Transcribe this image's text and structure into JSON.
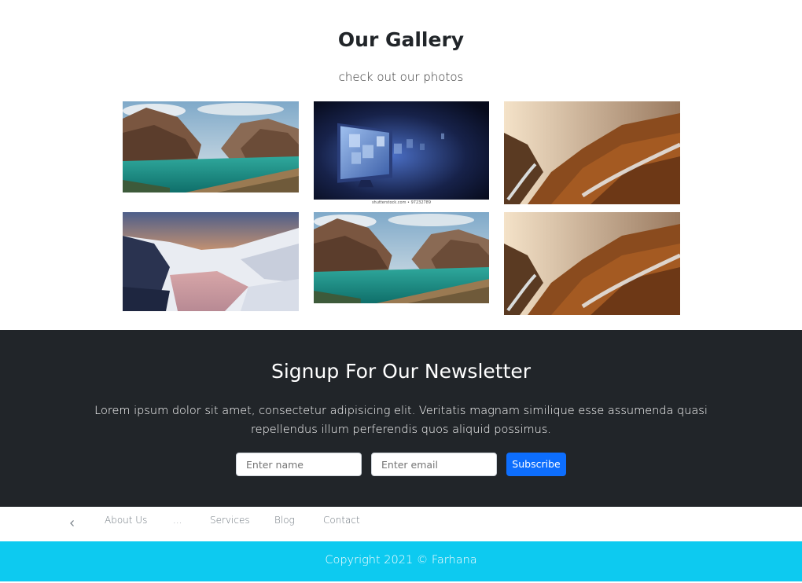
{
  "gallery": {
    "title": "Our Gallery",
    "subtitle": "check out our photos",
    "photos": [
      {
        "subject": "fjord-lake",
        "caption": ""
      },
      {
        "subject": "blue-monitor",
        "caption": "shutterstock.com • 97232789"
      },
      {
        "subject": "autumn-valley",
        "caption": ""
      },
      {
        "subject": "snow-lake-sunset",
        "caption": ""
      },
      {
        "subject": "fjord-lake",
        "caption": ""
      },
      {
        "subject": "autumn-valley",
        "caption": ""
      }
    ]
  },
  "newsletter": {
    "title": "Signup For Our Newsletter",
    "text": "Lorem ipsum dolor sit amet, consectetur adipisicing elit. Veritatis magnam similique esse assumenda quasi repellendus illum perferendis quos aliquid possimus.",
    "name_placeholder": "Enter name",
    "email_placeholder": "Enter email",
    "subscribe_label": "Subscribe"
  },
  "nav": {
    "back_icon": "chevron-left-icon",
    "items": [
      "About Us",
      "...",
      "Services",
      "Blog",
      "Contact"
    ]
  },
  "footer": {
    "copyright": "Copyright 2021 © Farhana"
  },
  "colors": {
    "dark": "#212529",
    "accent": "#0d6efd",
    "footer": "#0dcaf0"
  }
}
